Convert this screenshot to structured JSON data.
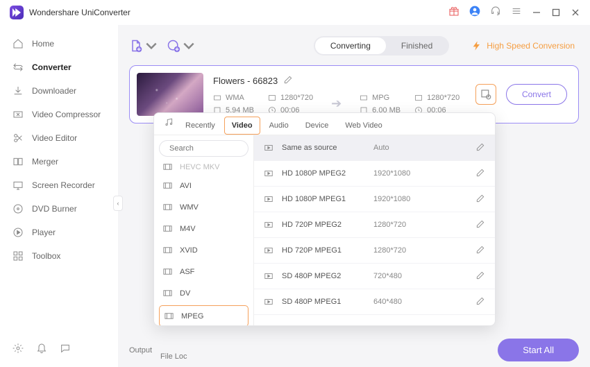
{
  "app": {
    "title": "Wondershare UniConverter"
  },
  "sidebar": {
    "items": [
      {
        "label": "Home"
      },
      {
        "label": "Converter"
      },
      {
        "label": "Downloader"
      },
      {
        "label": "Video Compressor"
      },
      {
        "label": "Video Editor"
      },
      {
        "label": "Merger"
      },
      {
        "label": "Screen Recorder"
      },
      {
        "label": "DVD Burner"
      },
      {
        "label": "Player"
      },
      {
        "label": "Toolbox"
      }
    ]
  },
  "tabs": {
    "converting": "Converting",
    "finished": "Finished"
  },
  "hsc": "High Speed Conversion",
  "file": {
    "name": "Flowers - 66823",
    "src": {
      "codec": "WMA",
      "res": "1280*720",
      "size": "5.94 MB",
      "dur": "00:06"
    },
    "dst": {
      "codec": "MPG",
      "res": "1280*720",
      "size": "6.00 MB",
      "dur": "00:06"
    }
  },
  "buttons": {
    "convert": "Convert",
    "startAll": "Start All"
  },
  "footer": {
    "output": "Output",
    "fileLoc": "File Loc"
  },
  "dropdown": {
    "tabs": [
      "Recently",
      "Video",
      "Audio",
      "Device",
      "Web Video"
    ],
    "searchPlaceholder": "Search",
    "formats": [
      {
        "label": "HEVC MKV",
        "cut": true
      },
      {
        "label": "AVI"
      },
      {
        "label": "WMV"
      },
      {
        "label": "M4V"
      },
      {
        "label": "XVID"
      },
      {
        "label": "ASF"
      },
      {
        "label": "DV"
      },
      {
        "label": "MPEG",
        "selected": true
      }
    ],
    "presets": [
      {
        "name": "Same as source",
        "res": "Auto",
        "head": true
      },
      {
        "name": "HD 1080P MPEG2",
        "res": "1920*1080"
      },
      {
        "name": "HD 1080P MPEG1",
        "res": "1920*1080"
      },
      {
        "name": "HD 720P MPEG2",
        "res": "1280*720"
      },
      {
        "name": "HD 720P MPEG1",
        "res": "1280*720"
      },
      {
        "name": "SD 480P MPEG2",
        "res": "720*480"
      },
      {
        "name": "SD 480P MPEG1",
        "res": "640*480"
      }
    ]
  }
}
